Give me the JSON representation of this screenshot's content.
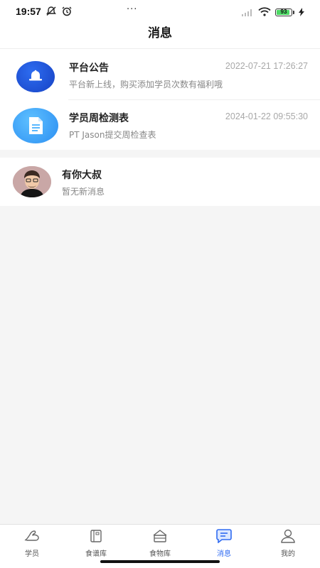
{
  "status_bar": {
    "time": "19:57",
    "dots": "···",
    "battery_level": "93",
    "battery_fraction": 0.93
  },
  "header": {
    "title": "消息"
  },
  "messages": [
    {
      "title": "平台公告",
      "time": "2022-07-21 17:26:27",
      "preview": "平台新上线，购买添加学员次数有福利哦",
      "icon": "bell-icon"
    },
    {
      "title": "学员周检测表",
      "time": "2024-01-22 09:55:30",
      "preview": "PT Jason提交周检查表",
      "icon": "document-icon"
    }
  ],
  "chats": [
    {
      "name": "有你大叔",
      "preview": "暂无新消息",
      "icon": "avatar"
    }
  ],
  "tabs": [
    {
      "label": "学员",
      "icon": "muscle-arm-icon",
      "active": false
    },
    {
      "label": "食谱库",
      "icon": "recipe-book-icon",
      "active": false
    },
    {
      "label": "食物库",
      "icon": "food-box-icon",
      "active": false
    },
    {
      "label": "消息",
      "icon": "chat-bubble-icon",
      "active": true
    },
    {
      "label": "我的",
      "icon": "person-icon",
      "active": false
    }
  ],
  "colors": {
    "accent": "#2f6bf2",
    "background": "#f5f5f5",
    "battery": "#4cd964"
  }
}
